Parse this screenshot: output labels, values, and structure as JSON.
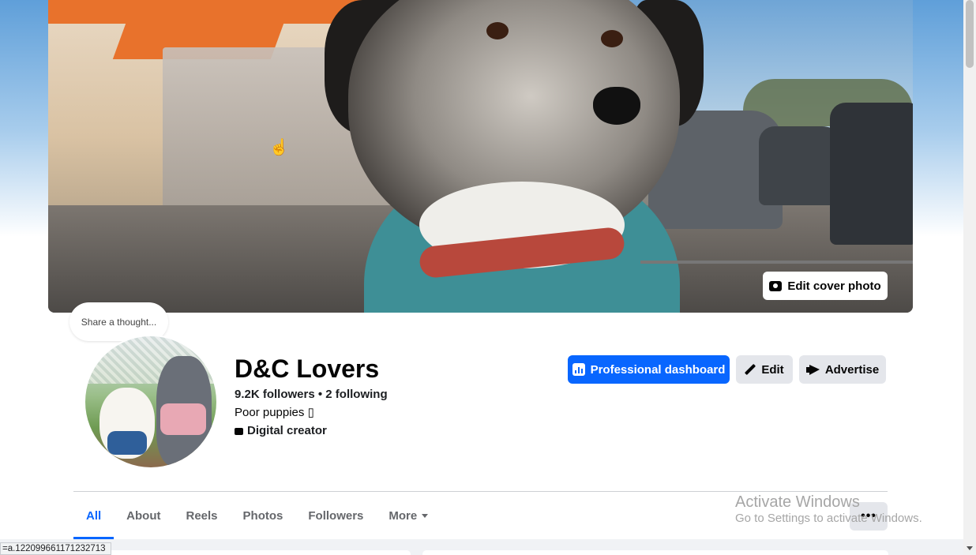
{
  "cover": {
    "edit_label": "Edit cover photo"
  },
  "thought_bubble": {
    "placeholder": "Share a thought..."
  },
  "profile": {
    "name": "D&C Lovers",
    "followers_line": "9.2K followers • 2 following",
    "bio": "Poor puppies ▯",
    "category": "Digital creator"
  },
  "actions": {
    "professional_dashboard": "Professional dashboard",
    "edit": "Edit",
    "advertise": "Advertise"
  },
  "tabs": [
    {
      "label": "All",
      "active": true
    },
    {
      "label": "About"
    },
    {
      "label": "Reels"
    },
    {
      "label": "Photos"
    },
    {
      "label": "Followers"
    },
    {
      "label": "More"
    }
  ],
  "more_button": "•••",
  "watermark": {
    "title": "Activate Windows",
    "subtitle": "Go to Settings to activate Windows."
  },
  "status_url": "=a.122099661171232713",
  "colors": {
    "accent": "#0866ff",
    "secondary_button": "#e4e6eb"
  }
}
